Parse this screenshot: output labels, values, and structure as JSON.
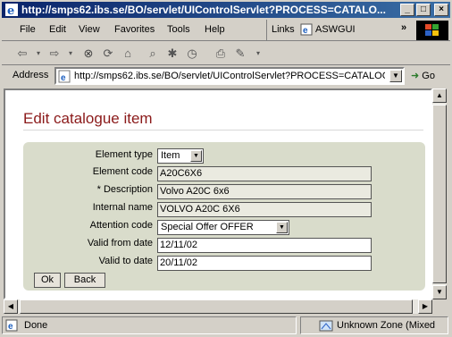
{
  "window": {
    "title": "http://smps62.ibs.se/BO/servlet/UIControlServlet?PROCESS=CATALO..."
  },
  "menu": {
    "file": "File",
    "edit": "Edit",
    "view": "View",
    "favorites": "Favorites",
    "tools": "Tools",
    "help": "Help"
  },
  "links": {
    "label": "Links",
    "item": "ASWGUI",
    "more": "»"
  },
  "address": {
    "label": "Address",
    "url": "http://smps62.ibs.se/BO/servlet/UIControlServlet?PROCESS=CATALOG",
    "go": "Go"
  },
  "page": {
    "title": "Edit catalogue item"
  },
  "form": {
    "element_type": {
      "label": "Element type",
      "value": "Item"
    },
    "element_code": {
      "label": "Element code",
      "value": "A20C6X6"
    },
    "description": {
      "label": "* Description",
      "value": "Volvo A20C 6x6"
    },
    "internal_name": {
      "label": "Internal name",
      "value": "VOLVO A20C 6X6"
    },
    "attention_code": {
      "label": "Attention code",
      "value": "Special Offer OFFER"
    },
    "valid_from": {
      "label": "Valid from date",
      "value": "12/11/02"
    },
    "valid_to": {
      "label": "Valid to date",
      "value": "20/11/02"
    },
    "ok": "Ok",
    "back": "Back"
  },
  "status": {
    "text": "Done",
    "zone": "Unknown Zone (Mixed"
  },
  "colors": {
    "title_text": "#8b1a1a",
    "panel": "#d9dccb",
    "titlebar": "#0a246a"
  }
}
